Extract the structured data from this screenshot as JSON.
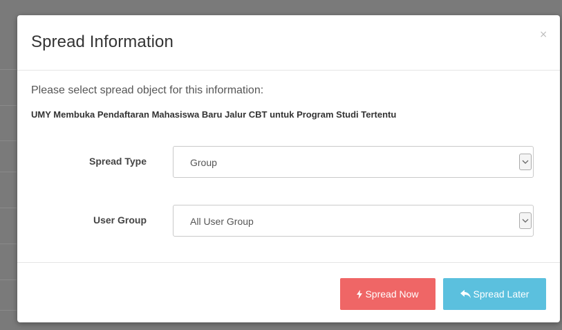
{
  "modal": {
    "title": "Spread Information",
    "close_symbol": "×",
    "instruction": "Please select spread object for this information:",
    "info_title": "UMY Membuka Pendaftaran Mahasiswa Baru Jalur CBT untuk Program Studi Tertentu",
    "fields": {
      "spread_type": {
        "label": "Spread Type",
        "value": "Group"
      },
      "user_group": {
        "label": "User Group",
        "value": "All User Group"
      }
    },
    "buttons": {
      "spread_now": {
        "label": "Spread Now",
        "icon": "bolt-icon",
        "color": "#ef6666"
      },
      "spread_later": {
        "label": "Spread Later",
        "icon": "reply-icon",
        "color": "#5bc0de"
      }
    }
  }
}
